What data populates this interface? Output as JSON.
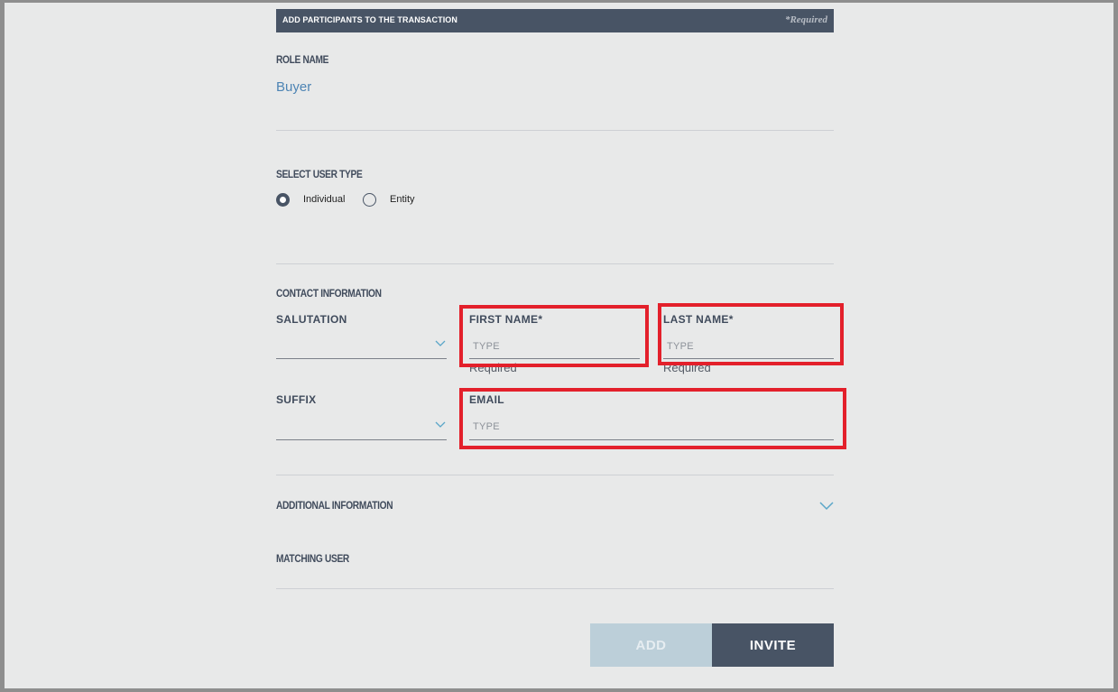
{
  "header": {
    "title": "ADD PARTICIPANTS TO THE TRANSACTION",
    "required_note": "*Required"
  },
  "role": {
    "label": "ROLE NAME",
    "value": "Buyer"
  },
  "user_type": {
    "label": "SELECT USER TYPE",
    "options": [
      {
        "label": "Individual",
        "selected": true
      },
      {
        "label": "Entity",
        "selected": false
      }
    ]
  },
  "contact": {
    "label": "CONTACT INFORMATION",
    "salutation": {
      "label": "SALUTATION",
      "value": ""
    },
    "first_name": {
      "label": "FIRST NAME*",
      "placeholder": "TYPE",
      "value": "",
      "error": "Required"
    },
    "last_name": {
      "label": "LAST NAME*",
      "placeholder": "TYPE",
      "value": "",
      "error": "Required"
    },
    "suffix": {
      "label": "SUFFIX",
      "value": ""
    },
    "email": {
      "label": "EMAIL",
      "placeholder": "TYPE",
      "value": ""
    }
  },
  "additional_info": {
    "label": "ADDITIONAL INFORMATION"
  },
  "matching_user": {
    "label": "MATCHING USER"
  },
  "actions": {
    "add_label": "ADD",
    "invite_label": "INVITE"
  },
  "colors": {
    "header_bg": "#485465",
    "accent_link": "#4d84b4",
    "chevron": "#5aa6c8",
    "highlight": "#e3202b",
    "add_disabled": "#bccfd9"
  }
}
